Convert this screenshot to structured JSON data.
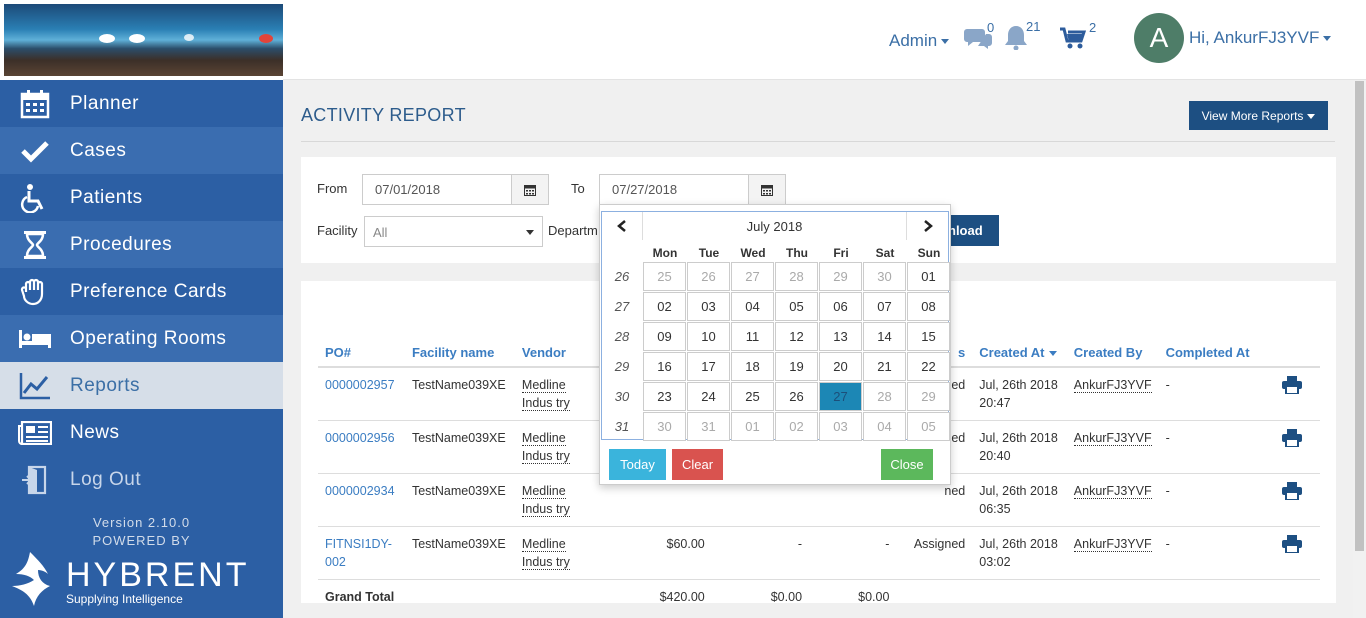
{
  "header": {
    "admin_label": "Admin",
    "messages_count": "0",
    "notifications_count": "21",
    "cart_count": "2",
    "avatar_letter": "A",
    "user_greeting": "Hi, AnkurFJ3YVF"
  },
  "sidebar": {
    "items": [
      {
        "label": "Planner",
        "icon": "calendar-icon"
      },
      {
        "label": "Cases",
        "icon": "check-icon"
      },
      {
        "label": "Patients",
        "icon": "wheelchair-icon"
      },
      {
        "label": "Procedures",
        "icon": "hourglass-icon"
      },
      {
        "label": "Preference Cards",
        "icon": "glove-icon"
      },
      {
        "label": "Operating Rooms",
        "icon": "bed-icon"
      },
      {
        "label": "Reports",
        "icon": "chart-icon"
      },
      {
        "label": "News",
        "icon": "newspaper-icon"
      },
      {
        "label": "Log Out",
        "icon": "logout-icon"
      }
    ],
    "version": "Version 2.10.0",
    "powered_by": "POWERED BY",
    "brand_name": "HYBRENT",
    "brand_tagline": "Supplying Intelligence"
  },
  "page": {
    "title": "ACTIVITY REPORT",
    "view_more_label": "View More Reports"
  },
  "filters": {
    "from_label": "From",
    "from_value": "07/01/2018",
    "to_label": "To",
    "to_value": "07/27/2018",
    "facility_label": "Facility",
    "facility_value": "All",
    "department_label": "Departm",
    "download_label": "nload"
  },
  "table": {
    "headers": [
      "PO#",
      "Facility name",
      "Vendor",
      "s",
      "Created At",
      "Created By",
      "Completed At"
    ],
    "rows": [
      {
        "po": "0000002957",
        "facility": "TestName039XE",
        "vendor": "Medline Indus try",
        "col4": "",
        "col5": "",
        "col6": "",
        "status": "ned",
        "created_at": "Jul, 26th 2018 20:47",
        "created_by": "AnkurFJ3YVF",
        "completed": "-"
      },
      {
        "po": "0000002956",
        "facility": "TestName039XE",
        "vendor": "Medline Indus try",
        "col4": "",
        "col5": "",
        "col6": "",
        "status": "ned",
        "created_at": "Jul, 26th 2018 20:40",
        "created_by": "AnkurFJ3YVF",
        "completed": "-"
      },
      {
        "po": "0000002934",
        "facility": "TestName039XE",
        "vendor": "Medline Indus try",
        "col4": "",
        "col5": "",
        "col6": "",
        "status": "ned",
        "created_at": "Jul, 26th 2018 06:35",
        "created_by": "AnkurFJ3YVF",
        "completed": "-"
      },
      {
        "po": "FITNSI1DY-002",
        "facility": "TestName039XE",
        "vendor": "Medline Indus try",
        "col4": "$60.00",
        "col5": "-",
        "col6": "-",
        "status": "Assigned",
        "created_at": "Jul, 26th 2018 03:02",
        "created_by": "AnkurFJ3YVF",
        "completed": "-"
      }
    ],
    "grand_total_label": "Grand Total",
    "grand_total_1": "$420.00",
    "grand_total_2": "$0.00",
    "grand_total_3": "$0.00"
  },
  "datepicker": {
    "month_label": "July 2018",
    "days_of_week": [
      "Mon",
      "Tue",
      "Wed",
      "Thu",
      "Fri",
      "Sat",
      "Sun"
    ],
    "weeks": [
      {
        "wk": "26",
        "days": [
          "25",
          "26",
          "27",
          "28",
          "29",
          "30",
          "01"
        ]
      },
      {
        "wk": "27",
        "days": [
          "02",
          "03",
          "04",
          "05",
          "06",
          "07",
          "08"
        ]
      },
      {
        "wk": "28",
        "days": [
          "09",
          "10",
          "11",
          "12",
          "13",
          "14",
          "15"
        ]
      },
      {
        "wk": "29",
        "days": [
          "16",
          "17",
          "18",
          "19",
          "20",
          "21",
          "22"
        ]
      },
      {
        "wk": "30",
        "days": [
          "23",
          "24",
          "25",
          "26",
          "27",
          "28",
          "29"
        ]
      },
      {
        "wk": "31",
        "days": [
          "30",
          "31",
          "01",
          "02",
          "03",
          "04",
          "05"
        ]
      }
    ],
    "selected_day": "27",
    "today_label": "Today",
    "clear_label": "Clear",
    "close_label": "Close"
  },
  "colors": {
    "sidebar": "#2c5fa4",
    "accent": "#1d4f82",
    "link": "#3b7dc2",
    "today_btn": "#3ab4dc",
    "clear_btn": "#d9534f",
    "close_btn": "#5cb85c"
  }
}
